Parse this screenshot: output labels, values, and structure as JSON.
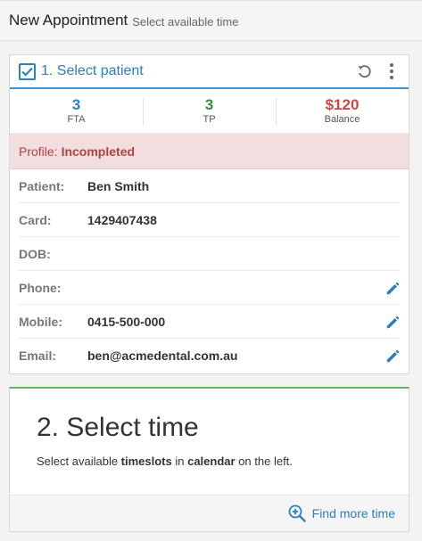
{
  "header": {
    "title": "New Appointment",
    "subtitle": "Select available time"
  },
  "patient_card": {
    "step_title": "1. Select patient",
    "stats": [
      {
        "value": "3",
        "label": "FTA",
        "color": "#2a7fc1"
      },
      {
        "value": "3",
        "label": "TP",
        "color": "#3c8a3c"
      },
      {
        "value": "$120",
        "label": "Balance",
        "color": "#c9473e"
      }
    ],
    "alert": {
      "label": "Profile:",
      "value": "Incompleted"
    },
    "fields": {
      "patient": {
        "label": "Patient:",
        "value": "Ben Smith"
      },
      "card": {
        "label": "Card:",
        "value": "1429407438"
      },
      "dob": {
        "label": "DOB:",
        "value": ""
      },
      "phone": {
        "label": "Phone:",
        "value": ""
      },
      "mobile": {
        "label": "Mobile:",
        "value": "0415-500-000"
      },
      "email": {
        "label": "Email:",
        "value": "ben@acmedental.com.au"
      }
    }
  },
  "time_card": {
    "title": "2. Select time",
    "instruction": {
      "part1": "Select available ",
      "bold1": "timeslots",
      "part2": " in ",
      "bold2": "calendar",
      "part3": " on the left."
    },
    "find_more_label": "Find more time"
  }
}
